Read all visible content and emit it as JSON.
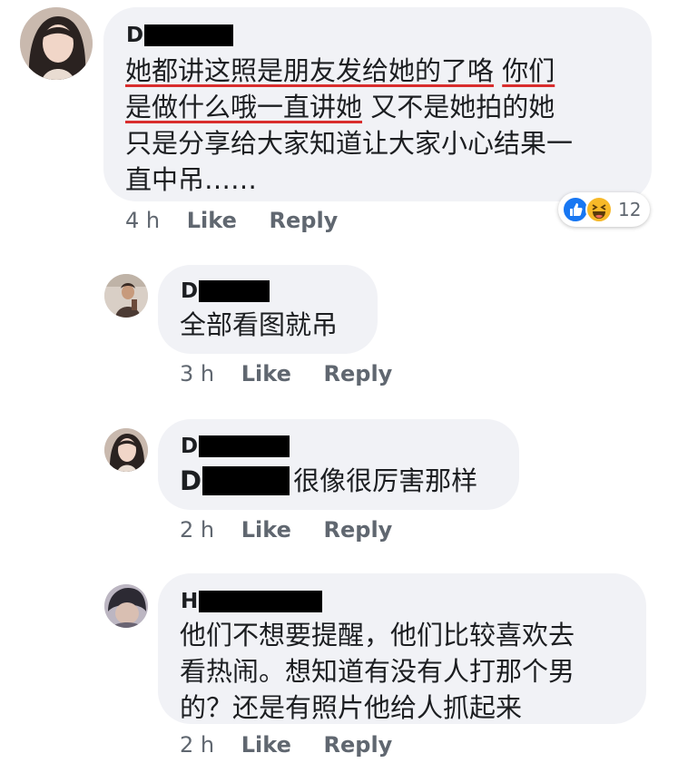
{
  "colors": {
    "bubble": "#f1f2f6",
    "underline": "#d92d2d",
    "meta": "#606770",
    "like_blue": "#1877f2",
    "haha_yellow": "#f7b928"
  },
  "comments": [
    {
      "name_initial": "D",
      "lines": [
        {
          "segments": [
            {
              "text": "她都讲这照是朋友发给她的了咯",
              "underline": true
            },
            {
              "text": " ",
              "underline": false
            },
            {
              "text": "你们",
              "underline": true
            }
          ]
        },
        {
          "segments": [
            {
              "text": "是做什么哦一直讲她",
              "underline": true
            },
            {
              "text": " 又不是她拍的她",
              "underline": false
            }
          ]
        },
        {
          "segments": [
            {
              "text": "只是分享给大家知道让大家小心结果一",
              "underline": false
            }
          ]
        },
        {
          "segments": [
            {
              "text": "直中吊……",
              "underline": false
            }
          ]
        }
      ],
      "time": "4 h",
      "like_label": "Like",
      "reply_label": "Reply",
      "reactions": {
        "icons": [
          "like-icon",
          "haha-icon"
        ],
        "count": "12"
      }
    },
    {
      "name_initial": "D",
      "text": "全部看图就吊",
      "time": "3 h",
      "like_label": "Like",
      "reply_label": "Reply"
    },
    {
      "name_initial": "D",
      "mention_initial": "D",
      "text": "很像很厉害那样",
      "time": "2 h",
      "like_label": "Like",
      "reply_label": "Reply"
    },
    {
      "name_initial": "H",
      "lines": [
        "他们不想要提醒，他们比较喜欢去",
        "看热闹。想知道有没有人打那个男",
        "的？还是有照片他给人抓起来"
      ],
      "time": "2 h",
      "like_label": "Like",
      "reply_label": "Reply"
    }
  ]
}
